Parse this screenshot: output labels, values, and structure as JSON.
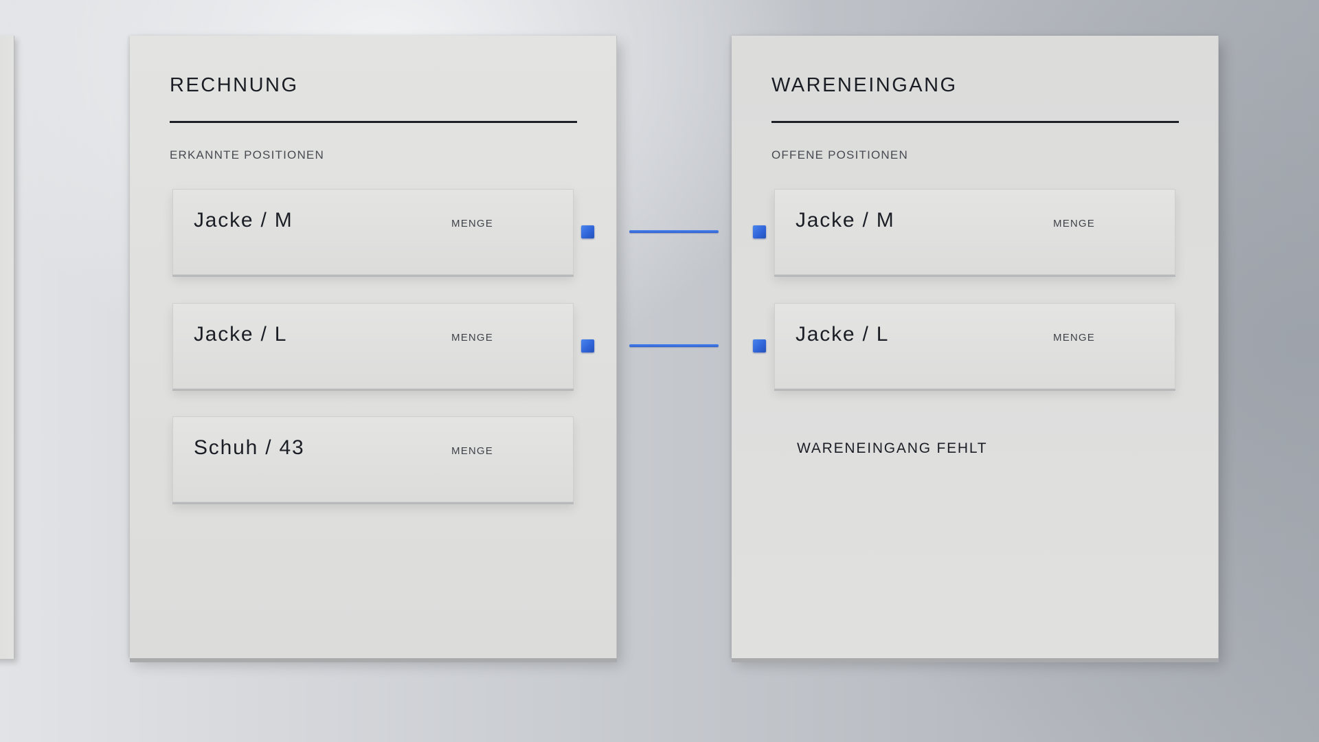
{
  "invoice": {
    "title": "RECHNUNG",
    "subtitle": "ERKANNTE POSITIONEN",
    "items": [
      {
        "name": "Jacke / M",
        "qty_label": "MENGE",
        "matched": true
      },
      {
        "name": "Jacke / L",
        "qty_label": "MENGE",
        "matched": true
      },
      {
        "name": "Schuh / 43",
        "qty_label": "MENGE",
        "matched": false
      }
    ]
  },
  "goods_receipt": {
    "title": "WARENEINGANG",
    "subtitle": "OFFENE POSITIONEN",
    "items": [
      {
        "name": "Jacke / M",
        "qty_label": "MENGE"
      },
      {
        "name": "Jacke / L",
        "qty_label": "MENGE"
      }
    ],
    "missing_note": "WARENEINGANG FEHLT"
  },
  "colors": {
    "connector": "#2e62d6",
    "text": "#1b1e25",
    "panel": "#dedede"
  }
}
